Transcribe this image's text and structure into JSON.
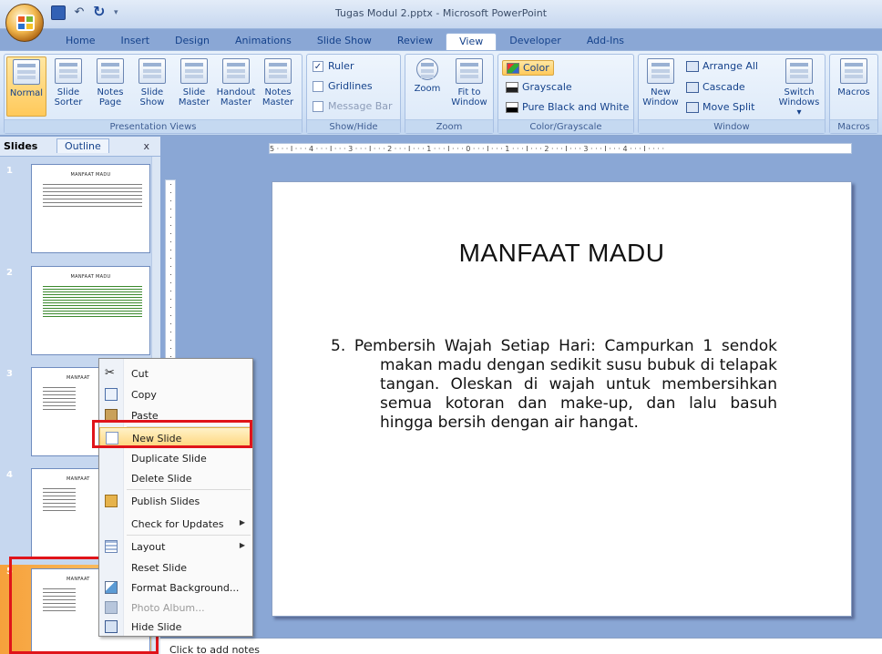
{
  "window": {
    "title": "Tugas Modul 2.pptx - Microsoft PowerPoint"
  },
  "ribbon_tabs": [
    {
      "label": "Home"
    },
    {
      "label": "Insert"
    },
    {
      "label": "Design"
    },
    {
      "label": "Animations"
    },
    {
      "label": "Slide Show"
    },
    {
      "label": "Review"
    },
    {
      "label": "View"
    },
    {
      "label": "Developer"
    },
    {
      "label": "Add-Ins"
    }
  ],
  "groups": {
    "presentation_views": {
      "label": "Presentation Views",
      "buttons": [
        "Normal",
        "Slide\nSorter",
        "Notes\nPage",
        "Slide\nShow",
        "Slide\nMaster",
        "Handout\nMaster",
        "Notes\nMaster"
      ]
    },
    "show_hide": {
      "label": "Show/Hide",
      "ruler": "Ruler",
      "gridlines": "Gridlines",
      "message_bar": "Message Bar"
    },
    "zoom": {
      "label": "Zoom",
      "zoom": "Zoom",
      "fit": "Fit to\nWindow"
    },
    "color": {
      "label": "Color/Grayscale",
      "color": "Color",
      "grayscale": "Grayscale",
      "pure": "Pure Black and White"
    },
    "window": {
      "label": "Window",
      "new_window": "New\nWindow",
      "arrange": "Arrange All",
      "cascade": "Cascade",
      "move_split": "Move Split",
      "switch": "Switch\nWindows ▾"
    },
    "macros": {
      "label": "Macros",
      "macros": "Macros"
    }
  },
  "panel": {
    "tab_slides": "Slides",
    "tab_outline": "Outline",
    "close": "x"
  },
  "thumbnails": [
    {
      "num": "1",
      "title": "MANFAAT MADU"
    },
    {
      "num": "2",
      "title": "MANFAAT MADU"
    },
    {
      "num": "3",
      "title": "MANFAAT"
    },
    {
      "num": "4",
      "title": "MANFAAT"
    },
    {
      "num": "5",
      "title": "MANFAAT"
    }
  ],
  "ruler_text": "5 · · · I · · · 4 · · · I · · · 3 · · · I · · · 2 · · · I · · · 1 · · · I · · · 0 · · · I · · · 1 · · · I · · · 2 · · · I · · · 3 · · · I · · · 4 · · · I · · · ·",
  "slide": {
    "title": "MANFAAT MADU",
    "body": "5.  Pembersih Wajah Setiap Hari: Campurkan 1 sendok makan madu dengan sedikit susu bubuk di telapak tangan. Oleskan di wajah untuk membersihkan semua kotoran dan make-up, dan lalu basuh hingga bersih dengan air hangat."
  },
  "notes": {
    "placeholder": "Click to add notes"
  },
  "context_menu": [
    {
      "label": "Cut"
    },
    {
      "label": "Copy"
    },
    {
      "label": "Paste"
    },
    {
      "label": "New Slide"
    },
    {
      "label": "Duplicate Slide"
    },
    {
      "label": "Delete Slide"
    },
    {
      "label": "Publish Slides"
    },
    {
      "label": "Check for Updates"
    },
    {
      "label": "Layout"
    },
    {
      "label": "Reset Slide"
    },
    {
      "label": "Format Background..."
    },
    {
      "label": "Photo Album..."
    },
    {
      "label": "Hide Slide"
    }
  ]
}
